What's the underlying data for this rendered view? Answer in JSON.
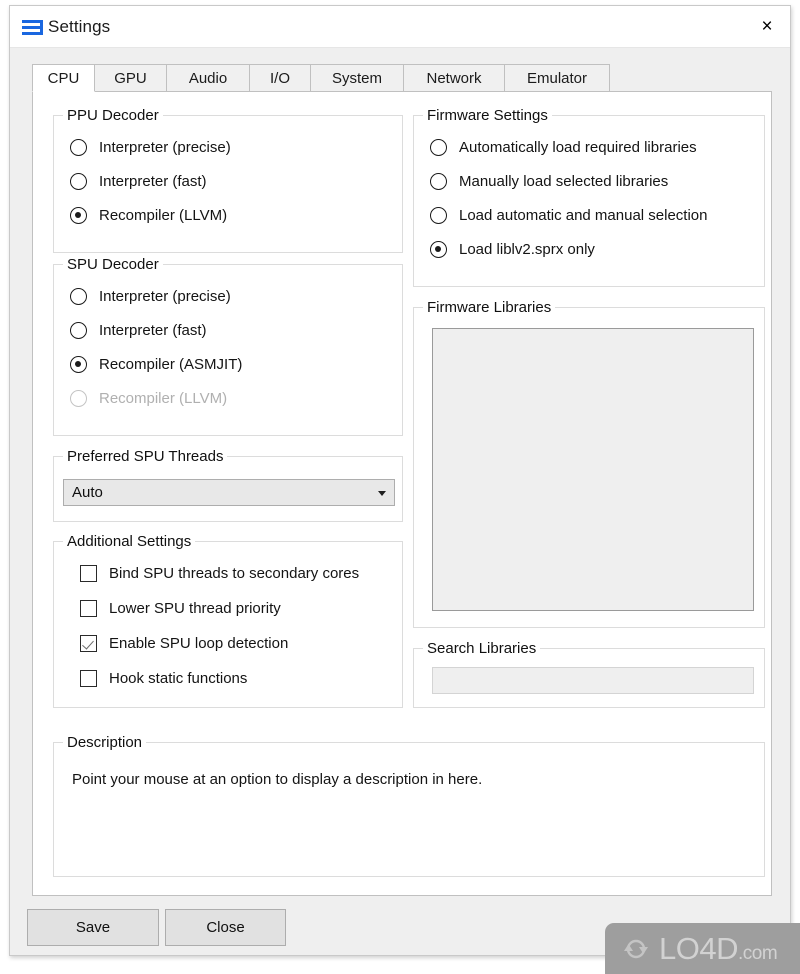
{
  "window": {
    "title": "Settings",
    "logo_icon": "rpcs3-logo-icon",
    "close_icon": "×"
  },
  "tabs": [
    {
      "label": "CPU",
      "active": true
    },
    {
      "label": "GPU",
      "active": false
    },
    {
      "label": "Audio",
      "active": false
    },
    {
      "label": "I/O",
      "active": false
    },
    {
      "label": "System",
      "active": false
    },
    {
      "label": "Network",
      "active": false
    },
    {
      "label": "Emulator",
      "active": false
    }
  ],
  "ppu_decoder": {
    "title": "PPU Decoder",
    "options": [
      {
        "label": "Interpreter (precise)",
        "selected": false,
        "disabled": false
      },
      {
        "label": "Interpreter (fast)",
        "selected": false,
        "disabled": false
      },
      {
        "label": "Recompiler (LLVM)",
        "selected": true,
        "disabled": false
      }
    ]
  },
  "spu_decoder": {
    "title": "SPU Decoder",
    "options": [
      {
        "label": "Interpreter (precise)",
        "selected": false,
        "disabled": false
      },
      {
        "label": "Interpreter (fast)",
        "selected": false,
        "disabled": false
      },
      {
        "label": "Recompiler (ASMJIT)",
        "selected": true,
        "disabled": false
      },
      {
        "label": "Recompiler (LLVM)",
        "selected": false,
        "disabled": true
      }
    ]
  },
  "preferred_spu_threads": {
    "title": "Preferred SPU Threads",
    "value": "Auto"
  },
  "additional_settings": {
    "title": "Additional Settings",
    "options": [
      {
        "label": "Bind SPU threads to secondary cores",
        "checked": false
      },
      {
        "label": "Lower SPU thread priority",
        "checked": false
      },
      {
        "label": "Enable SPU loop detection",
        "checked": true
      },
      {
        "label": "Hook static functions",
        "checked": false
      }
    ]
  },
  "firmware_settings": {
    "title": "Firmware Settings",
    "options": [
      {
        "label": "Automatically load required libraries",
        "selected": false
      },
      {
        "label": "Manually load selected libraries",
        "selected": false
      },
      {
        "label": "Load automatic and manual selection",
        "selected": false
      },
      {
        "label": "Load liblv2.sprx only",
        "selected": true
      }
    ]
  },
  "firmware_libraries": {
    "title": "Firmware Libraries",
    "items": []
  },
  "search_libraries": {
    "title": "Search Libraries",
    "value": "",
    "placeholder": ""
  },
  "description": {
    "title": "Description",
    "text": "Point your mouse at an option to display a description in here."
  },
  "footer": {
    "save_label": "Save",
    "close_label": "Close"
  },
  "watermark": {
    "text": "LO4D",
    "suffix": ".com"
  }
}
